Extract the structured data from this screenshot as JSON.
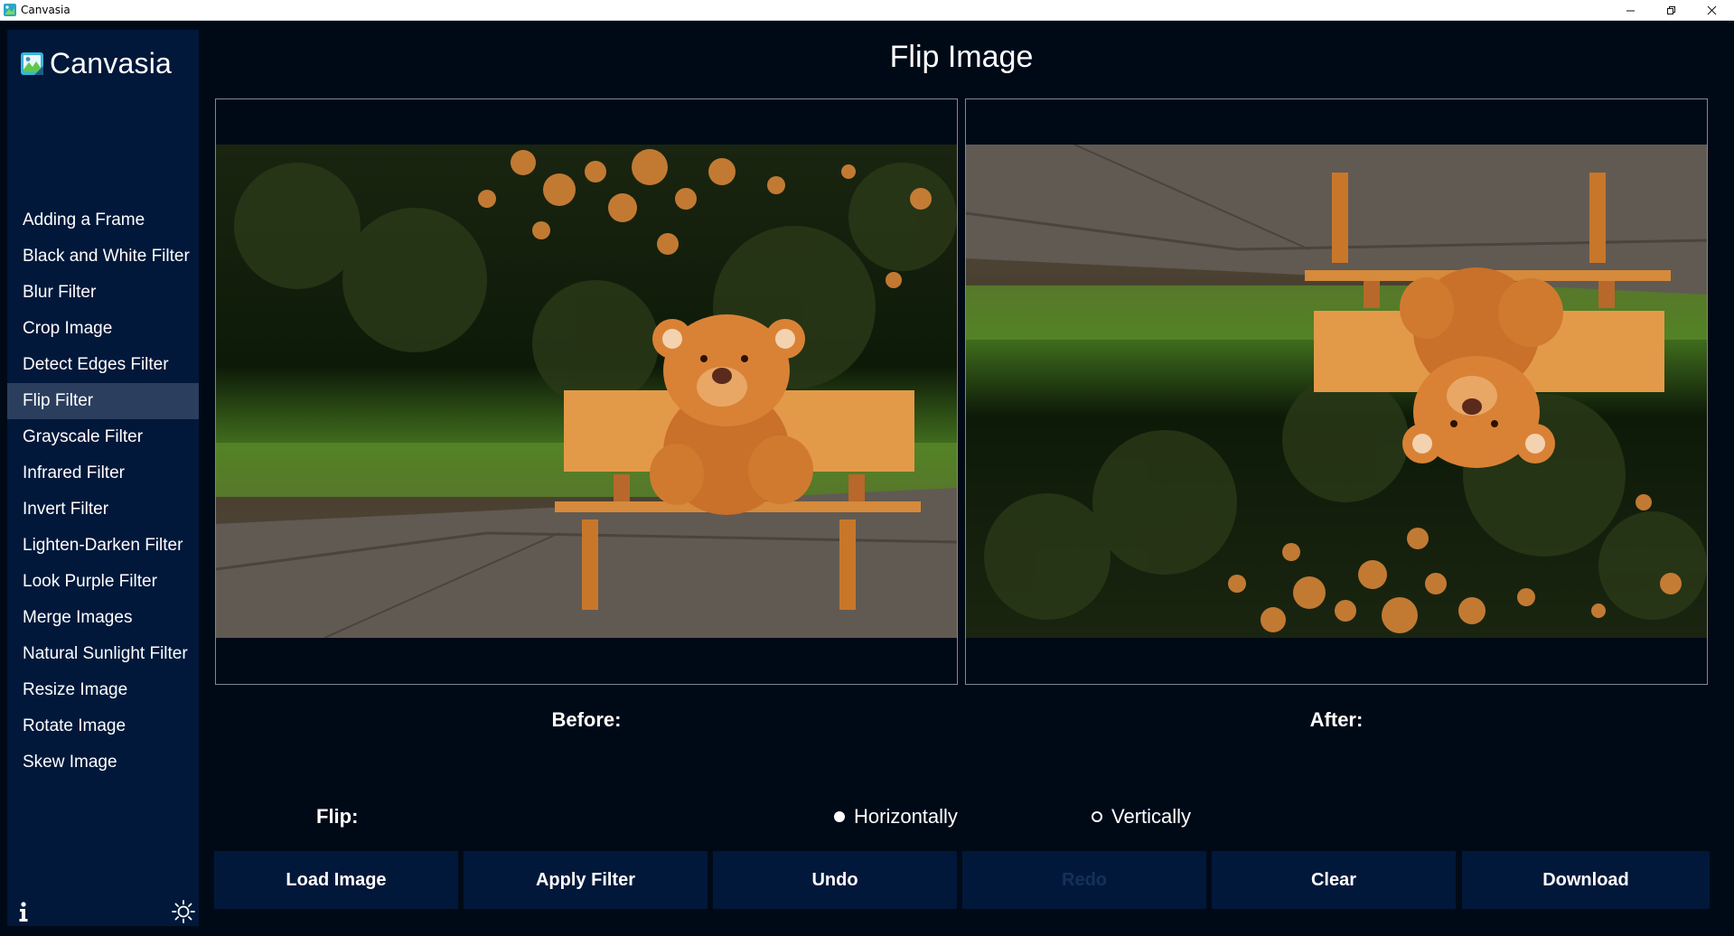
{
  "window": {
    "title": "Canvasia",
    "controls": [
      "minimize-icon",
      "restore-icon",
      "close-icon"
    ]
  },
  "sidebar": {
    "brand": "Canvasia",
    "items": [
      {
        "label": "Adding a Frame"
      },
      {
        "label": "Black and White Filter"
      },
      {
        "label": "Blur Filter"
      },
      {
        "label": "Crop Image"
      },
      {
        "label": "Detect Edges Filter"
      },
      {
        "label": "Flip Filter",
        "active": true
      },
      {
        "label": "Grayscale Filter"
      },
      {
        "label": "Infrared Filter"
      },
      {
        "label": "Invert Filter"
      },
      {
        "label": "Lighten-Darken Filter"
      },
      {
        "label": "Look Purple Filter"
      },
      {
        "label": "Merge Images"
      },
      {
        "label": "Natural Sunlight Filter"
      },
      {
        "label": "Resize Image"
      },
      {
        "label": "Rotate Image"
      },
      {
        "label": "Skew Image"
      }
    ],
    "footer_icons": [
      "info-icon",
      "sun-icon"
    ]
  },
  "main": {
    "title": "Flip Image",
    "before_label": "Before:",
    "after_label": "After:",
    "flip_label": "Flip:",
    "options": {
      "horizontal": "Horizontally",
      "vertical": "Vertically",
      "selected": "Horizontally"
    },
    "buttons": {
      "load": "Load Image",
      "apply": "Apply Filter",
      "undo": "Undo",
      "redo": "Redo",
      "clear": "Clear",
      "download": "Download"
    }
  },
  "colors": {
    "background": "#000a17",
    "sidebar": "#01183a",
    "active_item": "#2b3e5e",
    "button": "#01183a",
    "disabled_text": "#15305a"
  }
}
